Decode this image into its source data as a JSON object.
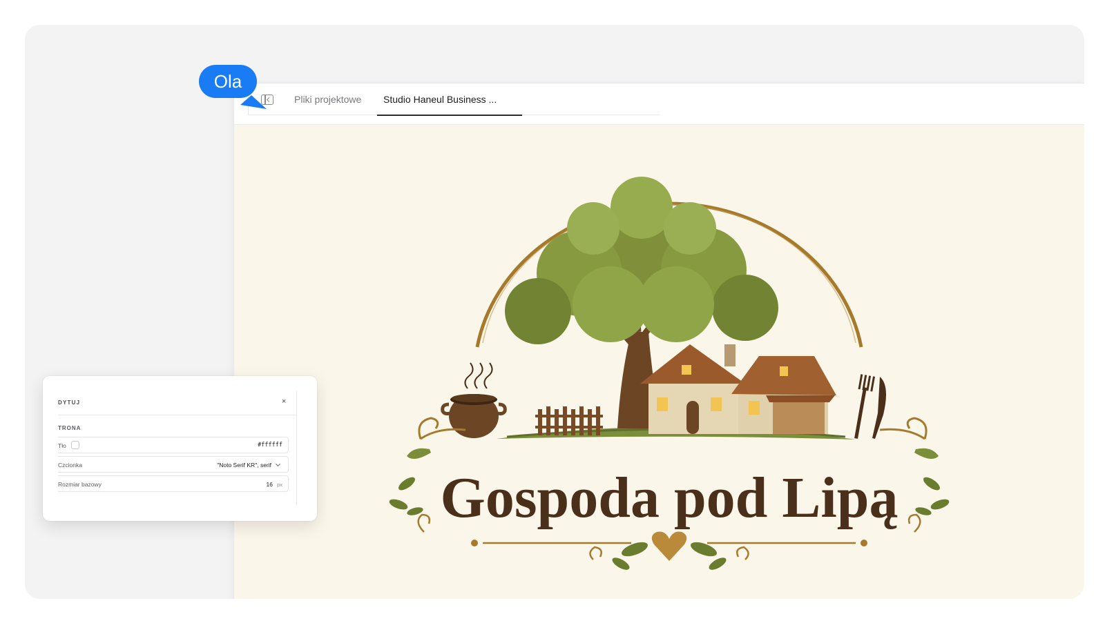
{
  "collaborator": {
    "name": "Ola",
    "color": "#1a7cf5"
  },
  "tabs": [
    {
      "label": "Pliki projektowe",
      "active": false
    },
    {
      "label": "Studio Haneul Business ...",
      "active": true
    }
  ],
  "logo": {
    "name": "Gospoda pod Lipą",
    "text_color": "#4a2f1a",
    "accent_color": "#a67a2c",
    "background_color": "#fbf6ea"
  },
  "edit_panel": {
    "title": "DYTUJ",
    "close_label": "×",
    "section": "TRONA",
    "fields": {
      "background": {
        "label": "Tło",
        "value": "#ffffff"
      },
      "font": {
        "label": "Czcionka",
        "value": "\"Noto Serif KR\", serif"
      },
      "base_size": {
        "label": "Rozmiar bazowy",
        "value": "16",
        "unit": "px"
      }
    }
  }
}
